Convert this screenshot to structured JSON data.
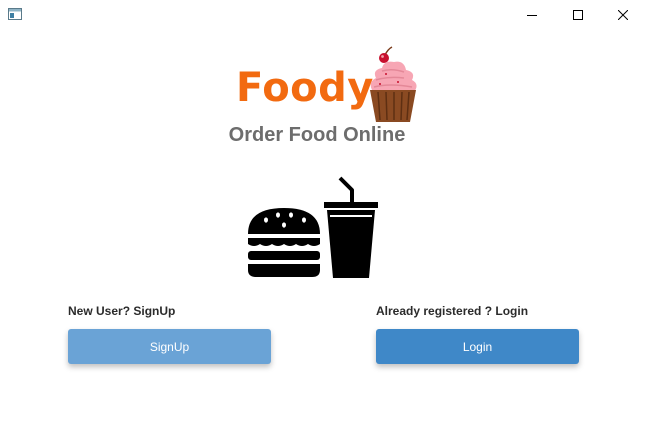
{
  "window": {
    "controls": {
      "minimize_icon": "minimize-icon",
      "maximize_icon": "maximize-icon",
      "close_icon": "close-icon"
    }
  },
  "brand": {
    "name": "Foody",
    "tagline": "Order Food Online",
    "colors": {
      "brand": "#f26a10",
      "tagline": "#6d6d6d"
    }
  },
  "illustration": {
    "icons": [
      "cupcake-icon",
      "burger-icon",
      "drink-cup-icon"
    ]
  },
  "signup": {
    "prompt": "New User? SignUp",
    "button_label": "SignUp",
    "color": "#6aa3d6"
  },
  "login": {
    "prompt": "Already registered ? Login",
    "button_label": "Login",
    "color": "#3f88c8"
  }
}
